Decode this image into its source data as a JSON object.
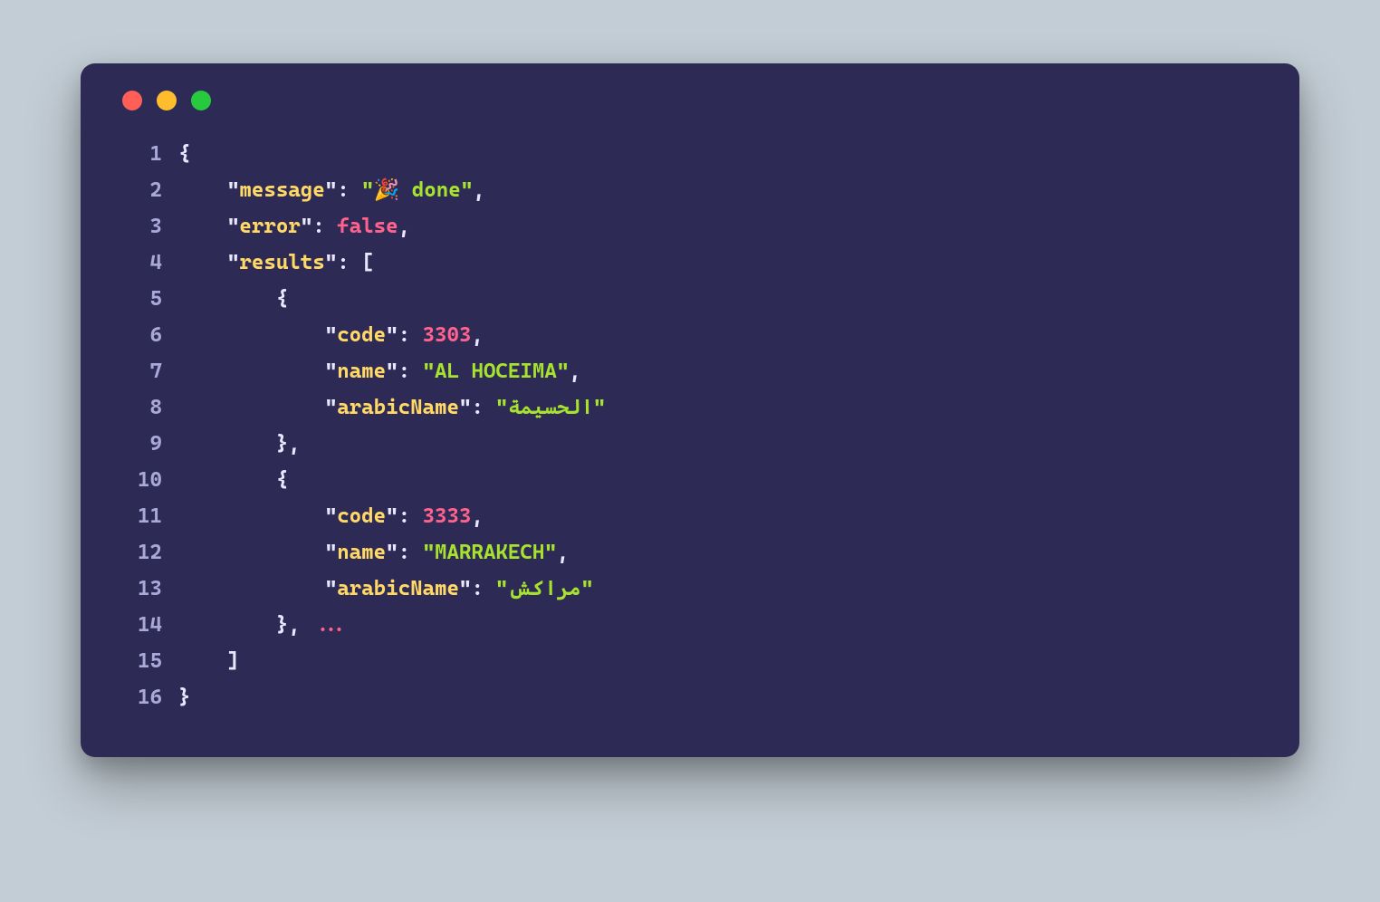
{
  "traffic": {
    "red": "#ff5f56",
    "yellow": "#ffbd2e",
    "green": "#27c93f"
  },
  "lineNumbers": [
    "1",
    "2",
    "3",
    "4",
    "5",
    "6",
    "7",
    "8",
    "9",
    "10",
    "11",
    "12",
    "13",
    "14",
    "15",
    "16"
  ],
  "tokens": {
    "open_brace": "{",
    "close_brace": "}",
    "open_bracket": "[",
    "close_bracket": "]",
    "comma": ",",
    "colon": ":",
    "quote": "\"",
    "ellipsis": "..."
  },
  "json": {
    "message_key": "message",
    "message_val": "🎉 done",
    "error_key": "error",
    "error_val": "false",
    "results_key": "results",
    "r0": {
      "code_key": "code",
      "code_val": "3303",
      "name_key": "name",
      "name_val": "AL HOCEIMA",
      "arabic_key": "arabicName",
      "arabic_val": "الحسيمة"
    },
    "r1": {
      "code_key": "code",
      "code_val": "3333",
      "name_key": "name",
      "name_val": "MARRAKECH",
      "arabic_key": "arabicName",
      "arabic_val": "مراكش"
    }
  }
}
